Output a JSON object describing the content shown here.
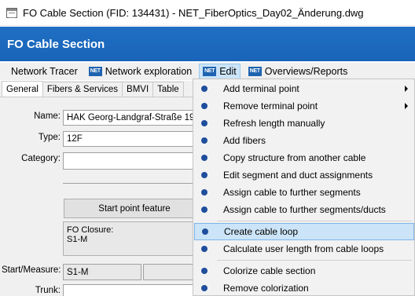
{
  "window": {
    "title": "FO Cable Section (FID: 134431) - NET_FiberOptics_Day02_Änderung.dwg"
  },
  "header": {
    "title": "FO Cable Section"
  },
  "menubar": {
    "items": [
      {
        "label": "Network Tracer",
        "icon": ""
      },
      {
        "label": "Network exploration",
        "icon": "NET"
      },
      {
        "label": "Edit",
        "icon": "NET"
      },
      {
        "label": "Overviews/Reports",
        "icon": "NET"
      }
    ]
  },
  "tabs": [
    "General",
    "Fibers & Services",
    "BMVI",
    "Table"
  ],
  "form": {
    "name_label": "Name:",
    "name_value": "HAK Georg-Landgraf-Straße 19",
    "type_label": "Type:",
    "type_value": "12F",
    "category_label": "Category:",
    "category_value": "",
    "start_button": "Start point feature",
    "start_info_line1": "FO Closure:",
    "start_info_line2": "S1-M",
    "start_measure_label": "Start/Measure:",
    "start_measure_value": "S1-M",
    "trunk_label": "Trunk:"
  },
  "edit_menu": {
    "items": [
      {
        "label": "Add terminal point",
        "submenu": true
      },
      {
        "label": "Remove terminal point",
        "submenu": true
      },
      {
        "label": "Refresh length manually",
        "submenu": false
      },
      {
        "label": "Add fibers",
        "submenu": false
      },
      {
        "label": "Copy structure from another cable",
        "submenu": false
      },
      {
        "label": "Edit segment and duct assignments",
        "submenu": false
      },
      {
        "label": "Assign cable to further segments",
        "submenu": false
      },
      {
        "label": "Assign cable to further segments/ducts",
        "submenu": false
      },
      {
        "label": "Create cable loop",
        "submenu": false,
        "highlighted": true
      },
      {
        "label": "Calculate user length from cable loops",
        "submenu": false
      },
      {
        "label": "Colorize cable section",
        "submenu": false
      },
      {
        "label": "Remove colorization",
        "submenu": false
      }
    ]
  },
  "colors": {
    "header_blue": "#1f6fc4",
    "bullet_blue": "#1f4e9c",
    "highlight": "#cce4f7"
  }
}
